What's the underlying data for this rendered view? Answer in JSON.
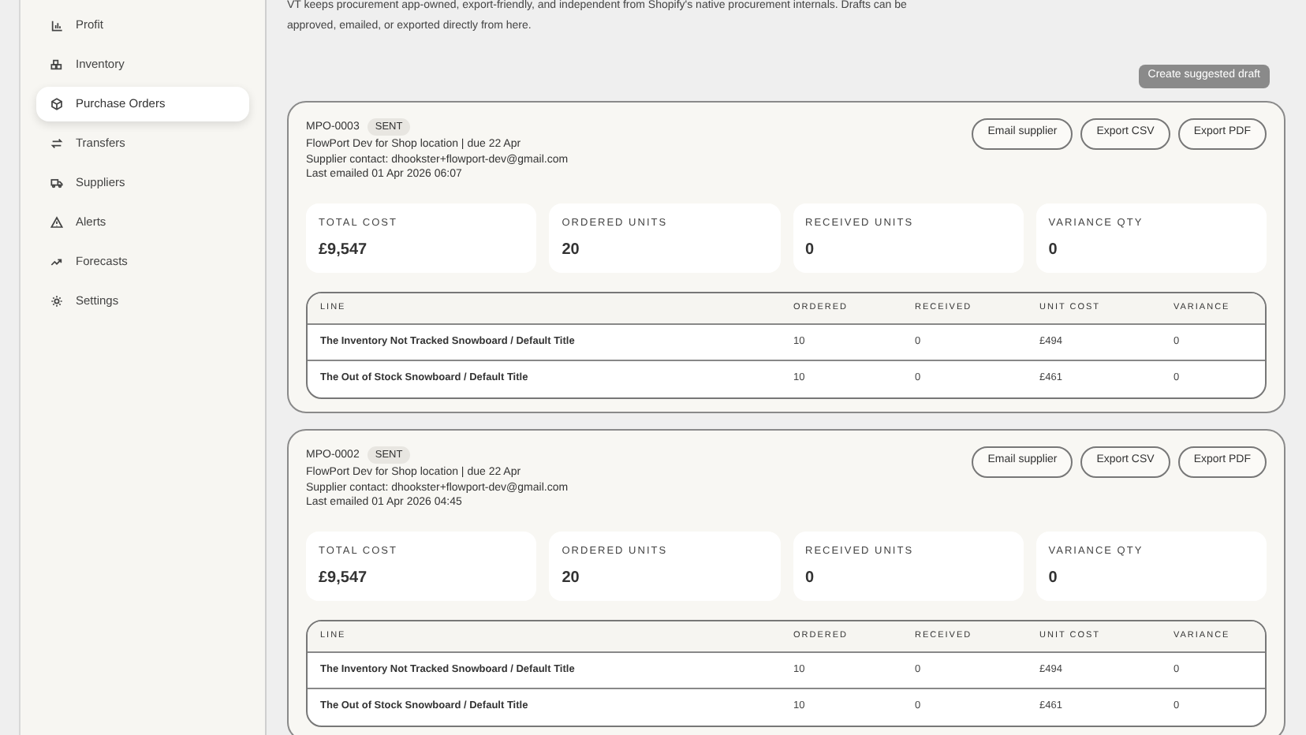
{
  "sidebar": {
    "items": [
      {
        "label": "Profit",
        "kind": "chart",
        "selected": false
      },
      {
        "label": "Inventory",
        "kind": "boxes",
        "selected": false
      },
      {
        "label": "Purchase Orders",
        "kind": "package",
        "selected": true
      },
      {
        "label": "Transfers",
        "kind": "arrows",
        "selected": false
      },
      {
        "label": "Suppliers",
        "kind": "truck",
        "selected": false
      },
      {
        "label": "Alerts",
        "kind": "alert",
        "selected": false
      },
      {
        "label": "Forecasts",
        "kind": "trend",
        "selected": false
      },
      {
        "label": "Settings",
        "kind": "gear",
        "selected": false
      }
    ]
  },
  "intro": "VT keeps procurement app-owned, export-friendly, and independent from Shopify's native procurement internals. Drafts can be approved, emailed, or exported directly from here.",
  "create_button": "Create suggested draft",
  "orders": [
    {
      "id": "MPO-0003",
      "status": "SENT",
      "location_due": "FlowPort Dev for Shop location | due 22 Apr",
      "contact": "Supplier contact: dhookster+flowport-dev@gmail.com",
      "last_emailed": "Last emailed 01 Apr 2026 06:07",
      "actions": [
        "Email supplier",
        "Export CSV",
        "Export PDF"
      ],
      "stats": [
        {
          "label": "TOTAL COST",
          "value": "£9,547"
        },
        {
          "label": "ORDERED UNITS",
          "value": "20"
        },
        {
          "label": "RECEIVED UNITS",
          "value": "0"
        },
        {
          "label": "VARIANCE QTY",
          "value": "0"
        }
      ],
      "table": {
        "columns": [
          "LINE",
          "ORDERED",
          "RECEIVED",
          "UNIT COST",
          "VARIANCE"
        ],
        "rows": [
          [
            "The Inventory Not Tracked Snowboard / Default Title",
            "10",
            "0",
            "£494",
            "0"
          ],
          [
            "The Out of Stock Snowboard / Default Title",
            "10",
            "0",
            "£461",
            "0"
          ]
        ]
      }
    },
    {
      "id": "MPO-0002",
      "status": "SENT",
      "location_due": "FlowPort Dev for Shop location | due 22 Apr",
      "contact": "Supplier contact: dhookster+flowport-dev@gmail.com",
      "last_emailed": "Last emailed 01 Apr 2026 04:45",
      "actions": [
        "Email supplier",
        "Export CSV",
        "Export PDF"
      ],
      "stats": [
        {
          "label": "TOTAL COST",
          "value": "£9,547"
        },
        {
          "label": "ORDERED UNITS",
          "value": "20"
        },
        {
          "label": "RECEIVED UNITS",
          "value": "0"
        },
        {
          "label": "VARIANCE QTY",
          "value": "0"
        }
      ],
      "table": {
        "columns": [
          "LINE",
          "ORDERED",
          "RECEIVED",
          "UNIT COST",
          "VARIANCE"
        ],
        "rows": [
          [
            "The Inventory Not Tracked Snowboard / Default Title",
            "10",
            "0",
            "£494",
            "0"
          ],
          [
            "The Out of Stock Snowboard / Default Title",
            "10",
            "0",
            "£461",
            "0"
          ]
        ]
      }
    }
  ]
}
